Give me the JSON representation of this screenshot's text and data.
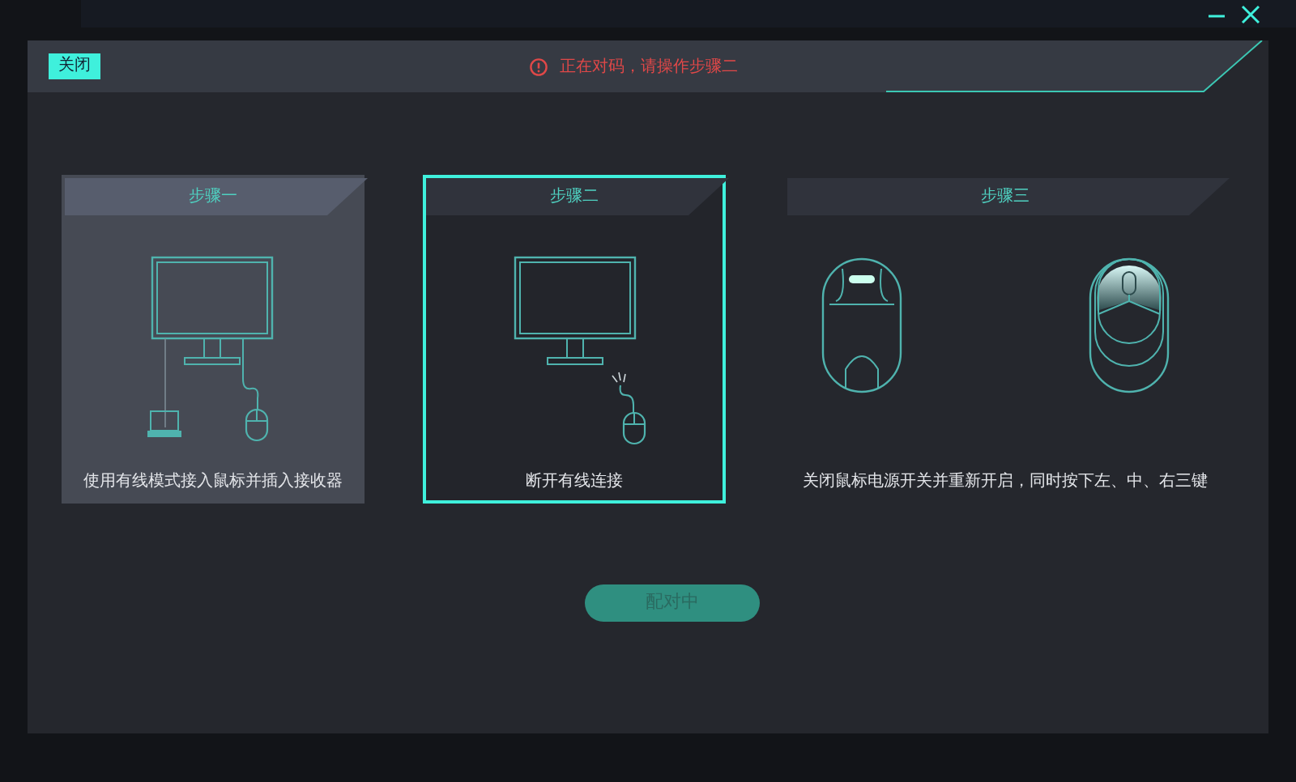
{
  "window": {
    "controls": [
      {
        "kind": "minimize"
      },
      {
        "kind": "close"
      }
    ]
  },
  "header": {
    "close_button": "关闭",
    "message": "正在对码，请操作步骤二"
  },
  "steps": [
    {
      "title": "步骤一",
      "kind": "connect",
      "selected": false,
      "highlighted": true,
      "caption": "使用有线模式接入鼠标并插入接收器"
    },
    {
      "title": "步骤二",
      "kind": "unplug",
      "selected": true,
      "highlighted": false,
      "caption": "断开有线连接"
    },
    {
      "title": "步骤三",
      "kind": "restart",
      "selected": false,
      "highlighted": false,
      "caption": "关闭鼠标电源开关并重新开启，同时按下左、中、右三键"
    }
  ],
  "pair_button": {
    "label": "配对中",
    "disabled": true
  }
}
